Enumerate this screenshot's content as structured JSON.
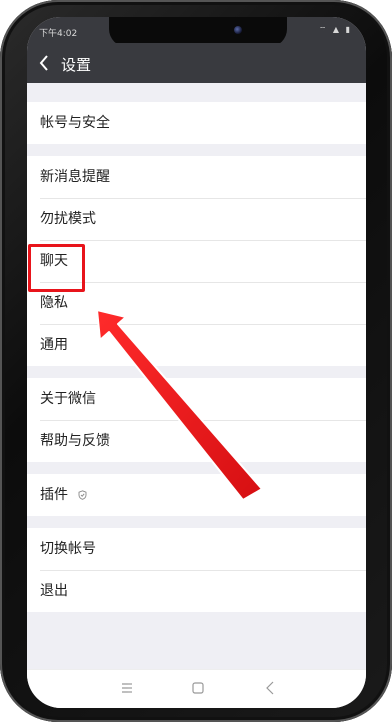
{
  "status_bar": {
    "time": "下午4:02",
    "icons": "⌔ ▲ ▮"
  },
  "nav": {
    "title": "设置"
  },
  "groups": [
    {
      "items": [
        {
          "label": "帐号与安全"
        }
      ]
    },
    {
      "items": [
        {
          "label": "新消息提醒"
        },
        {
          "label": "勿扰模式"
        },
        {
          "label": "聊天"
        },
        {
          "label": "隐私"
        },
        {
          "label": "通用"
        }
      ]
    },
    {
      "items": [
        {
          "label": "关于微信"
        },
        {
          "label": "帮助与反馈"
        }
      ]
    },
    {
      "items": [
        {
          "label": "插件"
        }
      ]
    },
    {
      "items": [
        {
          "label": "切换帐号"
        },
        {
          "label": "退出"
        }
      ]
    }
  ],
  "colors": {
    "nav_bg": "#393a3f",
    "page_bg": "#efeff4",
    "highlight": "#e8141b"
  },
  "icons": {
    "back": "chevron-left-icon",
    "plugin": "shield-icon",
    "menu": "menu-icon",
    "home": "square-icon",
    "back_nav": "triangle-back-icon"
  }
}
